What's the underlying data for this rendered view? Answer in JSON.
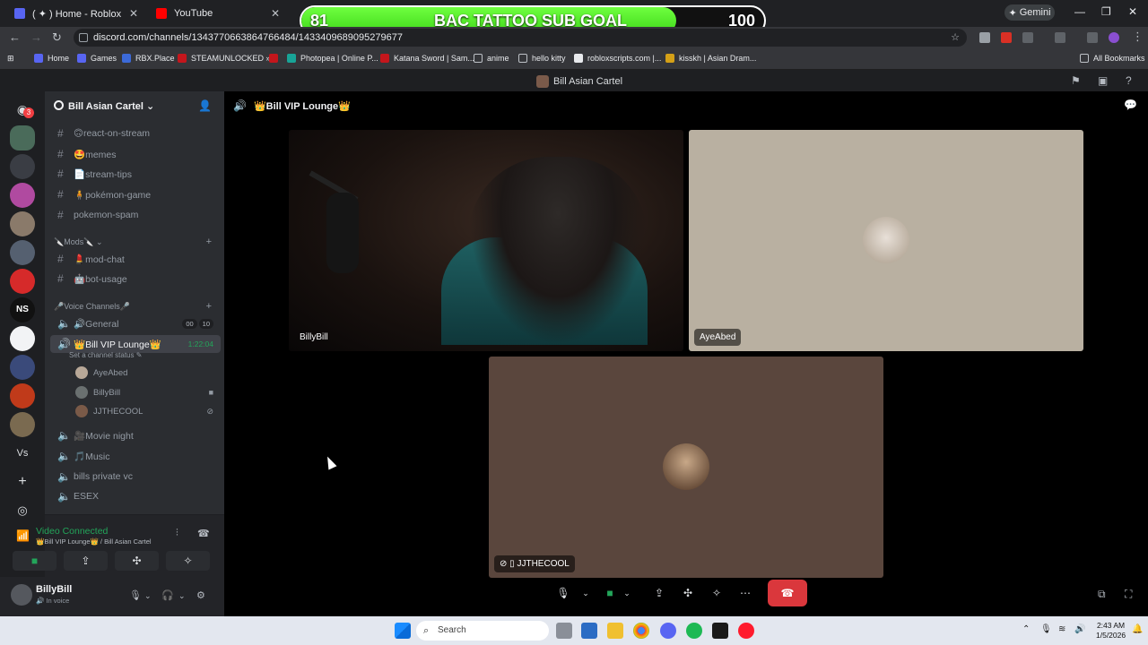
{
  "browser": {
    "tabs": [
      {
        "label": "( ✦ ) Home - Roblox",
        "icon": "roblox-icon"
      },
      {
        "label": "YouTube",
        "icon": "youtube-icon"
      }
    ],
    "url": "discord.com/channels/1343770663864766484/1433409689095279677",
    "gemini_label": "Gemini",
    "all_bookmarks": "All Bookmarks",
    "bookmarks": [
      "Home",
      "Games",
      "RBX.Place",
      "STEAMUNLOCKED »...",
      "Photopea | Online P...",
      "Katana Sword | Sam...",
      "anime",
      "hello kitty",
      "robloxscripts.com |...",
      "kisskh | Asian Dram..."
    ]
  },
  "overlay_goal": {
    "current": "81",
    "title": "BAC TATTOO SUB GOAL",
    "target": "100",
    "progress_fraction": 0.81
  },
  "discord": {
    "window_title": "Bill Asian Cartel",
    "home_badge": "3",
    "server_name": "Bill Asian Cartel",
    "channels_top": [
      {
        "name": "🙃react-on-stream"
      },
      {
        "name": "🤩memes"
      },
      {
        "name": "📄stream-tips"
      },
      {
        "name": "🧍pokémon-game"
      },
      {
        "name": "pokemon-spam"
      }
    ],
    "category_mods": "🔪Mods🔪",
    "channels_mods": [
      {
        "name": "💄mod-chat"
      },
      {
        "name": "🤖bot-usage"
      }
    ],
    "category_voice": "🎤Voice Channels🎤",
    "voice_channels": {
      "general": {
        "name": "🔊General",
        "count_a": "00",
        "count_b": "10"
      },
      "vip": {
        "name": "👑Bill VIP Lounge👑",
        "timer": "1:22:04",
        "status": "Set a channel status"
      },
      "movie": {
        "name": "🎥Movie night"
      },
      "music": {
        "name": "🎵Music"
      },
      "private": {
        "name": "bills private vc"
      },
      "esex": {
        "name": "ESEX"
      }
    },
    "members": [
      "AyeAbed",
      "BillyBill",
      "JJTHECOOL"
    ],
    "voice_panel": {
      "status": "Video Connected",
      "location": "👑Bill VIP Lounge👑 / Bill Asian Cartel"
    },
    "user": {
      "name": "BillyBill",
      "status": "In voice"
    },
    "stage_title": "👑Bill VIP Lounge👑",
    "tiles": [
      {
        "name": "BillyBill"
      },
      {
        "name": "AyeAbed"
      },
      {
        "name": "JJTHECOOL"
      }
    ]
  },
  "taskbar": {
    "search_placeholder": "Search",
    "time": "2:43 AM",
    "date": "1/5/2026"
  },
  "colors": {
    "accent_green": "#23a55a",
    "hangup_red": "#da373c",
    "stage_bg": "#000000",
    "goal_green": "#3fd81a"
  }
}
